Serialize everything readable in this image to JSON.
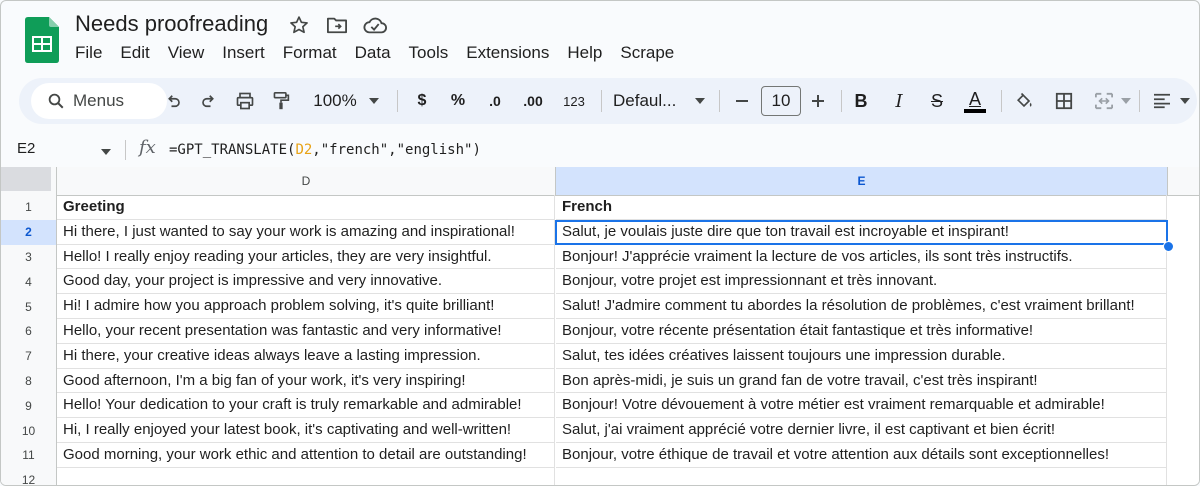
{
  "document": {
    "title": "Needs proofreading"
  },
  "menu": [
    "File",
    "Edit",
    "View",
    "Insert",
    "Format",
    "Data",
    "Tools",
    "Extensions",
    "Help",
    "Scrape"
  ],
  "toolbar": {
    "search_label": "Menus",
    "zoom": "100%",
    "currency": "$",
    "percent": "%",
    "decrease_decimal": ".0",
    "increase_decimal": ".00",
    "format_number": "123",
    "font": "Defaul...",
    "font_size": "10",
    "bold": "B",
    "italic": "I",
    "strike": "S",
    "text_color": "A"
  },
  "formula_bar": {
    "name_box": "E2",
    "formula_prefix": "=GPT_TRANSLATE(",
    "formula_ref": "D2",
    "formula_rest": ",\"french\",\"english\")"
  },
  "columns": [
    {
      "letter": "D",
      "selected": false
    },
    {
      "letter": "E",
      "selected": true
    }
  ],
  "rows": [
    {
      "num": "1",
      "d": "Greeting",
      "e": "French",
      "header": true
    },
    {
      "num": "2",
      "d": "Hi there, I just wanted to say your work is amazing and inspirational!",
      "e": "Salut, je voulais juste dire que ton travail est incroyable et inspirant!",
      "selected": true
    },
    {
      "num": "3",
      "d": "Hello! I really enjoy reading your articles, they are very insightful.",
      "e": "Bonjour! J'apprécie vraiment la lecture de vos articles, ils sont très instructifs."
    },
    {
      "num": "4",
      "d": "Good day, your project is impressive and very innovative.",
      "e": "Bonjour, votre projet est impressionnant et très innovant."
    },
    {
      "num": "5",
      "d": "Hi! I admire how you approach problem solving, it's quite brilliant!",
      "e": "Salut! J'admire comment tu abordes la résolution de problèmes, c'est vraiment brillant!"
    },
    {
      "num": "6",
      "d": "Hello, your recent presentation was fantastic and very informative!",
      "e": "Bonjour, votre récente présentation était fantastique et très informative!"
    },
    {
      "num": "7",
      "d": "Hi there, your creative ideas always leave a lasting impression.",
      "e": "Salut, tes idées créatives laissent toujours une impression durable."
    },
    {
      "num": "8",
      "d": "Good afternoon, I'm a big fan of your work, it's very inspiring!",
      "e": "Bon après-midi, je suis un grand fan de votre travail, c'est très inspirant!"
    },
    {
      "num": "9",
      "d": "Hello! Your dedication to your craft is truly remarkable and admirable!",
      "e": "Bonjour! Votre dévouement à votre métier est vraiment remarquable et admirable!"
    },
    {
      "num": "10",
      "d": "Hi, I really enjoyed your latest book, it's captivating and well-written!",
      "e": "Salut, j'ai vraiment apprécié votre dernier livre, il est captivant et bien écrit!"
    },
    {
      "num": "11",
      "d": "Good morning, your work ethic and attention to detail are outstanding!",
      "e": "Bonjour, votre éthique de travail et votre attention aux détails sont exceptionnelles!"
    },
    {
      "num": "12",
      "d": "",
      "e": ""
    }
  ],
  "colors": {
    "accent": "#1a73e8",
    "header_selected": "#d3e3fd",
    "formula_ref": "#e8a317",
    "sheets_green": "#0f9d58"
  }
}
